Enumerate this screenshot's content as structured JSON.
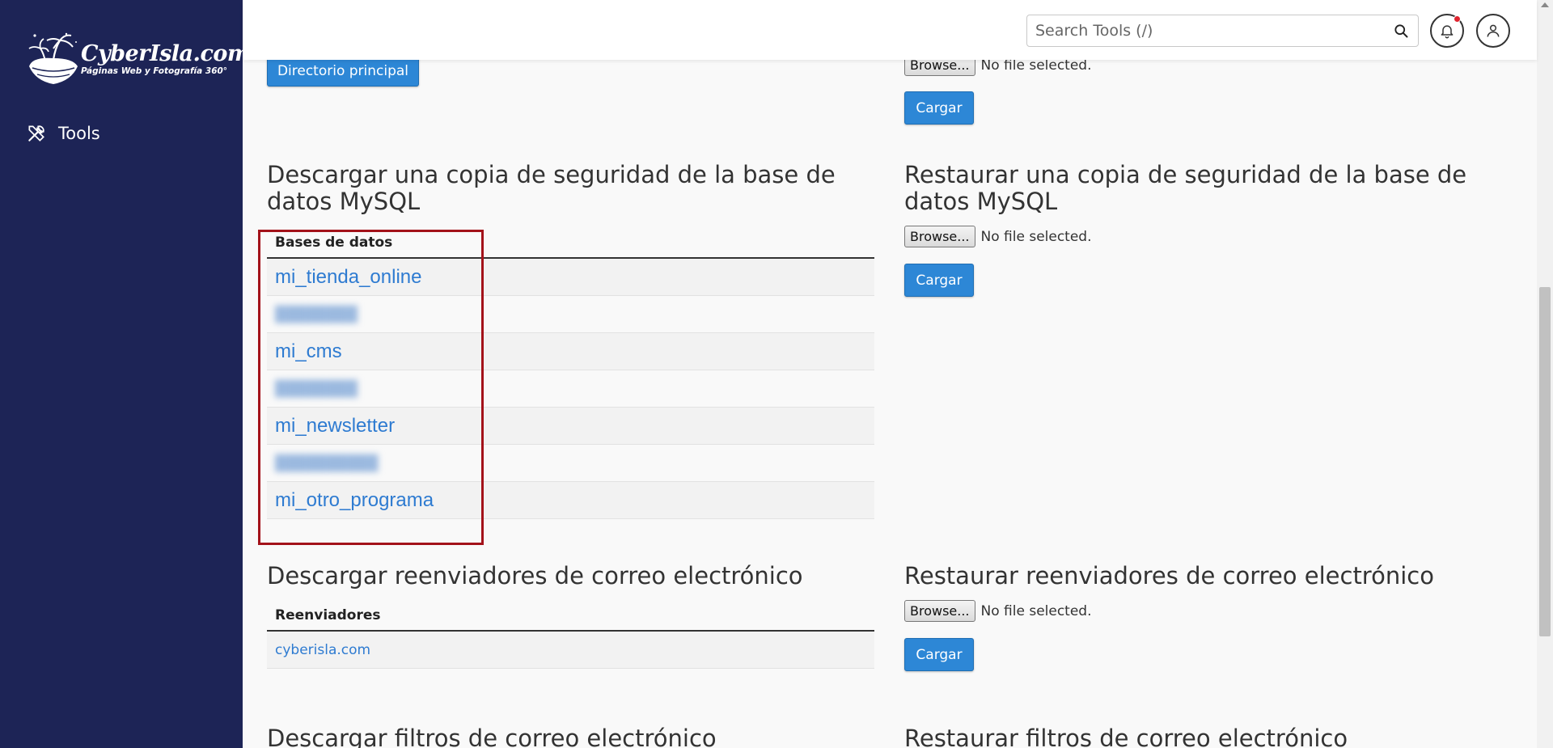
{
  "sidebar": {
    "logo": {
      "name": "CyberIsla.com",
      "tagline": "Páginas Web y Fotografía 360°"
    },
    "nav": {
      "tools_label": "Tools"
    }
  },
  "header": {
    "search": {
      "placeholder": "Search Tools (/)"
    },
    "notification_color": "#e0242f"
  },
  "top": {
    "home_dir_button": "Directorio principal",
    "file": {
      "browse_label": "Browse...",
      "status": "No file selected."
    },
    "upload_button": "Cargar"
  },
  "mysql_download": {
    "title": "Descargar una copia de seguridad de la base de datos MySQL",
    "column_header": "Bases de datos",
    "rows": [
      {
        "name": "mi_tienda_online",
        "redacted": false
      },
      {
        "name": "",
        "redacted": true
      },
      {
        "name": "mi_cms",
        "redacted": false
      },
      {
        "name": "",
        "redacted": true
      },
      {
        "name": "mi_newsletter",
        "redacted": false
      },
      {
        "name": "",
        "redacted": true
      },
      {
        "name": "mi_otro_programa",
        "redacted": false
      }
    ]
  },
  "mysql_restore": {
    "title": "Restaurar una copia de seguridad de la base de datos MySQL",
    "file": {
      "browse_label": "Browse...",
      "status": "No file selected."
    },
    "upload_button": "Cargar"
  },
  "forwarders_download": {
    "title": "Descargar reenviadores de correo electrónico",
    "column_header": "Reenviadores",
    "rows": [
      {
        "name": "cyberisla.com"
      }
    ]
  },
  "forwarders_restore": {
    "title": "Restaurar reenviadores de correo electrónico",
    "file": {
      "browse_label": "Browse...",
      "status": "No file selected."
    },
    "upload_button": "Cargar"
  },
  "filters_download": {
    "title": "Descargar filtros de correo electrónico"
  },
  "filters_restore": {
    "title": "Restaurar filtros de correo electrónico"
  },
  "colors": {
    "sidebar": "#1d2456",
    "primary_button": "#2d87d6",
    "link": "#2e7bd1",
    "highlight": "#a3121a"
  }
}
